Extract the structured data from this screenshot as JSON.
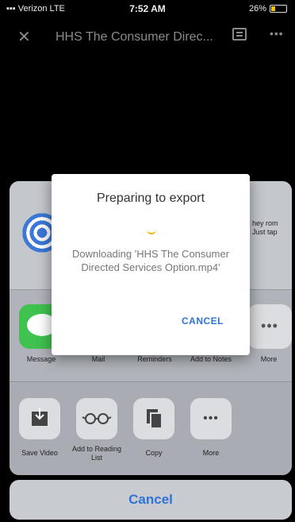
{
  "status_bar": {
    "carrier": "Verizon",
    "network": "LTE",
    "time": "7:52 AM",
    "battery": "26%",
    "battery_level": 0.26
  },
  "top_bar": {
    "title": "HHS The Consumer Direc...",
    "close_icon": "close-icon",
    "list_icon": "list-icon",
    "more_icon": "more-icon"
  },
  "share_sheet": {
    "airdrop_text": "hey rom Just tap",
    "apps": [
      {
        "label": "Message"
      },
      {
        "label": "Mail"
      },
      {
        "label": "Reminders"
      },
      {
        "label": "Add to Notes"
      },
      {
        "label": "More"
      }
    ],
    "actions": [
      {
        "label": "Save Video"
      },
      {
        "label": "Add to Reading List"
      },
      {
        "label": "Copy"
      },
      {
        "label": "More"
      }
    ],
    "cancel_label": "Cancel"
  },
  "dialog": {
    "title": "Preparing to export",
    "message": "Downloading 'HHS The Consumer Directed Services Option.mp4'",
    "cancel_label": "CANCEL"
  },
  "colors": {
    "accent": "#2f73d8",
    "spinner": "#f4b400",
    "messages_green": "#3fc24f"
  }
}
